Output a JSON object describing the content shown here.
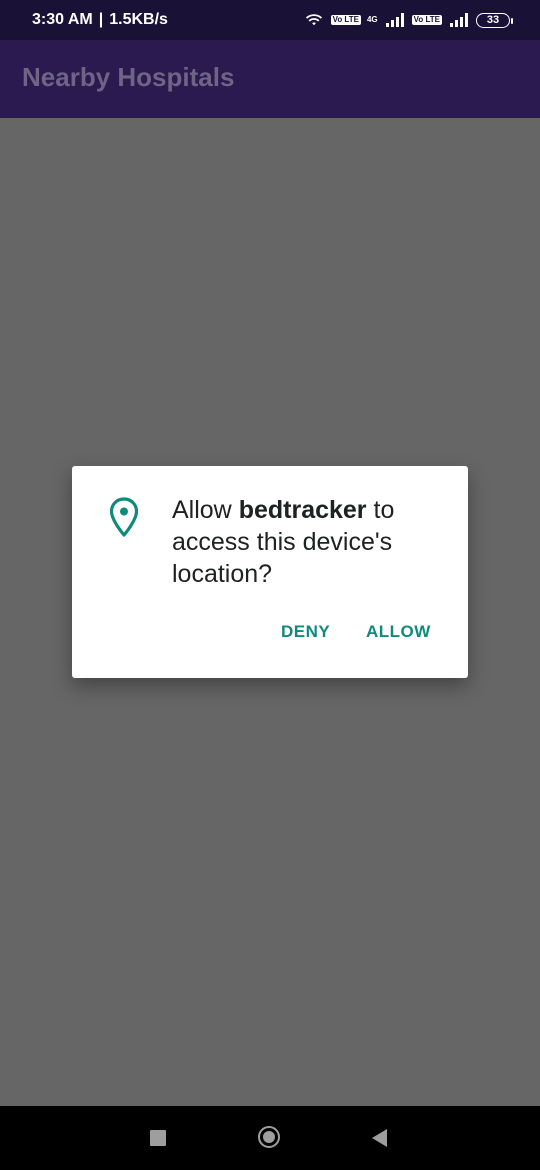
{
  "status_bar": {
    "time": "3:30 AM",
    "separator": "|",
    "network_speed": "1.5KB/s",
    "icons": [
      "wifi-icon",
      "volte-icon",
      "4g-signal-icon",
      "volte-icon",
      "signal-icon"
    ],
    "volte_label": "Vo LTE",
    "network_type": "4G",
    "battery_level": "33"
  },
  "app_bar": {
    "title": "Nearby Hospitals"
  },
  "permission_dialog": {
    "icon": "location-pin-icon",
    "message_prefix": "Allow ",
    "app_name": "bedtracker",
    "message_suffix": " to access this device's location?",
    "deny_label": "DENY",
    "allow_label": "ALLOW",
    "accent_color": "#0f8a7c"
  },
  "nav_bar": {
    "icons": [
      "recents-square-icon",
      "home-circle-icon",
      "back-triangle-icon"
    ]
  }
}
